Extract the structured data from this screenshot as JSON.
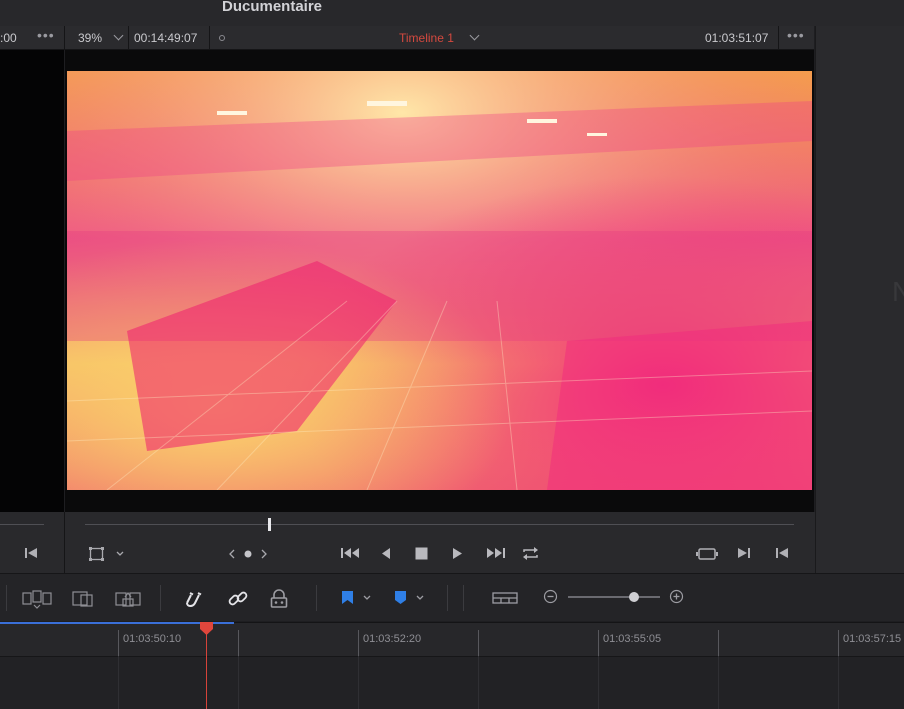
{
  "window": {
    "title": "Ducumentaire"
  },
  "viewer_left": {
    "timecode": ":00"
  },
  "viewer": {
    "zoom": "39%",
    "source_timecode": "00:14:49:07",
    "timeline_name": "Timeline 1",
    "record_timecode": "01:03:51:07",
    "playhead_position": 0.26,
    "transport": [
      "first-frame",
      "previous-frame",
      "stop",
      "play",
      "last-frame",
      "loop"
    ]
  },
  "right_panel": {
    "ghost_text": "N"
  },
  "toolbar": {
    "zoom_level": 0.67,
    "tools": [
      "snapping",
      "linked-selection",
      "position-lock",
      "flag",
      "marker",
      "view-options",
      "zoom-out",
      "zoom-in"
    ]
  },
  "timeline": {
    "ruler_labels": [
      "01:03:50:10",
      "01:03:52:20",
      "01:03:55:05",
      "01:03:57:15"
    ]
  },
  "colors": {
    "accent": "#d4493f",
    "flag": "#2f7fe6",
    "marker": "#2f7fe6",
    "playhead": "#e0463c"
  }
}
